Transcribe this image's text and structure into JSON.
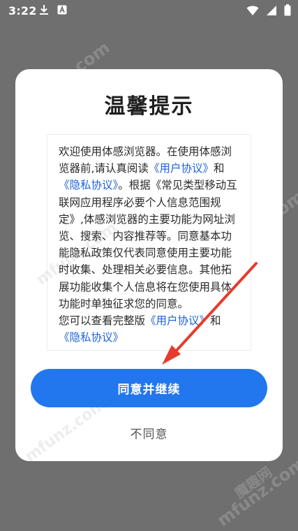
{
  "status_bar": {
    "time": "3:22",
    "left_icons": [
      "download-icon",
      "a-badge-icon"
    ],
    "right_icons": [
      "wifi-icon",
      "signal-icon",
      "battery-icon"
    ]
  },
  "dialog": {
    "title": "温馨提示",
    "body_intro": "欢迎使用体感浏览器。在使用体感浏览器前,请认真阅读",
    "link_user_agreement_1": "《用户协议》",
    "body_and_1": "和",
    "link_privacy_policy_1": "《隐私协议》",
    "body_main": "。根据《常见类型移动互联网应用程序必要个人信息范围规定》,体感浏览器的主要功能为网址浏览、搜索、内容推荐等。同意基本功能隐私政策仅代表同意使用主要功能时收集、处理相关必要信息。其他拓展功能收集个人信息将在您使用具体功能时单独征求您的同意。",
    "body_view_full": "您可以查看完整版",
    "link_user_agreement_2": "《用户协议》",
    "body_and_2": "和",
    "link_privacy_policy_2": "《隐私协议》",
    "agree_label": "同意并继续",
    "disagree_label": "不同意"
  },
  "colors": {
    "overlay": "#6f6f6f",
    "dialog_bg": "#ffffff",
    "primary_button": "#2277ee",
    "link": "#1e63d8",
    "arrow": "#e53b2c"
  },
  "watermark": {
    "text": "mfunz.com",
    "brand": "魔趣网"
  }
}
